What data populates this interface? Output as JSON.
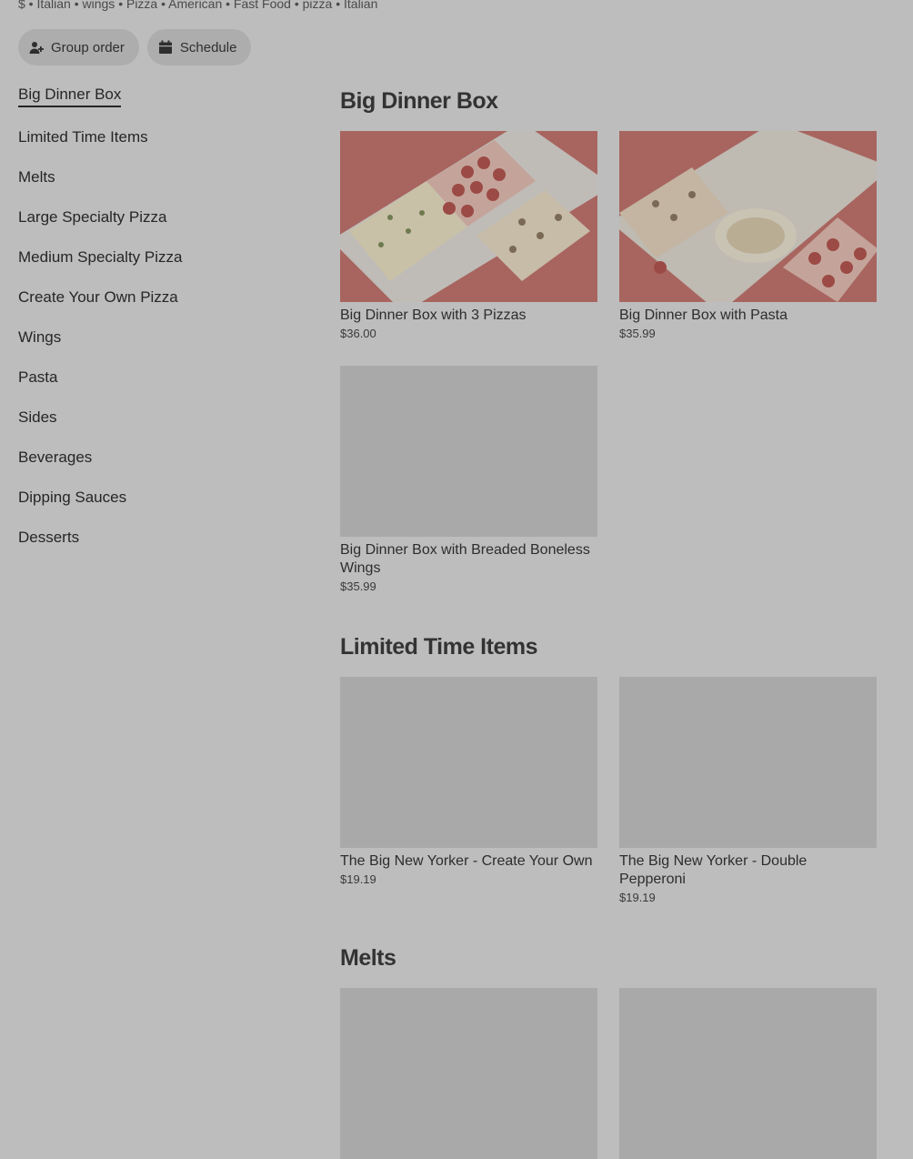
{
  "store": {
    "cuisine_line": "$ • Italian • wings • Pizza • American • Fast Food • pizza • Italian"
  },
  "actions": {
    "group_order": "Group order",
    "schedule": "Schedule"
  },
  "nav": [
    "Big Dinner Box",
    "Limited Time Items",
    "Melts",
    "Large Specialty Pizza",
    "Medium Specialty Pizza",
    "Create Your Own Pizza",
    "Wings",
    "Pasta",
    "Sides",
    "Beverages",
    "Dipping Sauces",
    "Desserts"
  ],
  "sections": {
    "big_dinner_box": {
      "title": "Big Dinner Box",
      "items": [
        {
          "name": "Big Dinner Box with 3 Pizzas",
          "price": "$36.00"
        },
        {
          "name": "Big Dinner Box with Pasta",
          "price": "$35.99"
        },
        {
          "name": "Big Dinner Box with Breaded Boneless Wings",
          "price": "$35.99"
        }
      ]
    },
    "limited_time_items": {
      "title": "Limited Time Items",
      "items": [
        {
          "name": "The Big New Yorker - Create Your Own",
          "price": "$19.19"
        },
        {
          "name": "The Big New Yorker - Double Pepperoni",
          "price": "$19.19"
        }
      ]
    },
    "melts": {
      "title": "Melts"
    }
  },
  "colors": {
    "overlay_background": "#bdbdbd",
    "image_placeholder": "#a9a9a9",
    "pizza_box_red": "#a8655f"
  }
}
